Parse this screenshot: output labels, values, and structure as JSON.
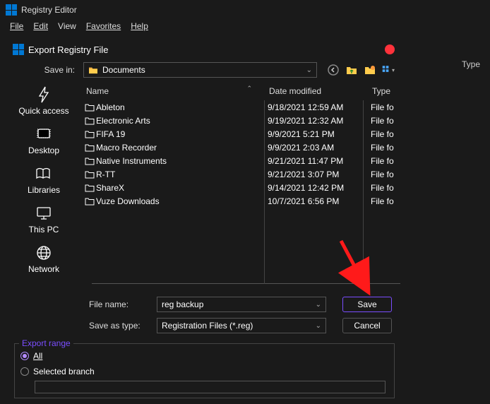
{
  "app": {
    "title": "Registry Editor"
  },
  "menu": {
    "file": "File",
    "edit": "Edit",
    "view": "View",
    "favorites": "Favorites",
    "help": "Help"
  },
  "dialog": {
    "title": "Export Registry File",
    "save_in_label": "Save in:",
    "save_in_value": "Documents",
    "columns": {
      "name": "Name",
      "date": "Date modified",
      "type": "Type"
    },
    "sidebar": {
      "quick_access": "Quick access",
      "desktop": "Desktop",
      "libraries": "Libraries",
      "this_pc": "This PC",
      "network": "Network"
    },
    "rows": [
      {
        "name": "Ableton",
        "date": "9/18/2021 12:59 AM",
        "type": "File fo"
      },
      {
        "name": "Electronic Arts",
        "date": "9/19/2021 12:32 AM",
        "type": "File fo"
      },
      {
        "name": "FIFA 19",
        "date": "9/9/2021 5:21 PM",
        "type": "File fo"
      },
      {
        "name": "Macro Recorder",
        "date": "9/9/2021 2:03 AM",
        "type": "File fo"
      },
      {
        "name": "Native Instruments",
        "date": "9/21/2021 11:47 PM",
        "type": "File fo"
      },
      {
        "name": "R-TT",
        "date": "9/21/2021 3:07 PM",
        "type": "File fo"
      },
      {
        "name": "ShareX",
        "date": "9/14/2021 12:42 PM",
        "type": "File fo"
      },
      {
        "name": "Vuze Downloads",
        "date": "10/7/2021 6:56 PM",
        "type": "File fo"
      }
    ],
    "file_name_label": "File name:",
    "file_name_value": "reg backup",
    "save_type_label": "Save as type:",
    "save_type_value": "Registration Files (*.reg)",
    "save_btn": "Save",
    "cancel_btn": "Cancel",
    "export_legend": "Export range",
    "opt_all": "All",
    "opt_branch": "Selected branch"
  },
  "bg": {
    "type_header": "Type"
  }
}
